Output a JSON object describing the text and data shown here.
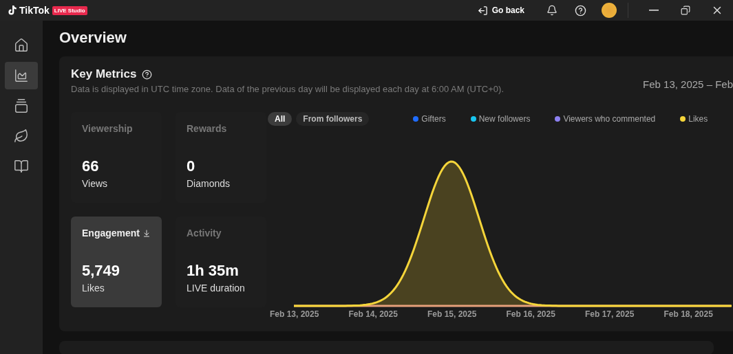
{
  "app": {
    "name": "TikTok",
    "badge": "LIVE Studio"
  },
  "titlebar": {
    "go_back": "Go back"
  },
  "sidebar": {
    "items": [
      {
        "selected": false
      },
      {
        "selected": true
      },
      {
        "selected": false
      },
      {
        "selected": false
      },
      {
        "selected": false
      }
    ]
  },
  "page_title": "Overview",
  "key_metrics": {
    "title": "Key Metrics",
    "note": "Data is displayed in UTC time zone. Data of the previous day will be displayed each day at 6:00 AM (UTC+0).",
    "date_range": "Feb 13, 2025 – Feb",
    "tiles": [
      {
        "title": "Viewership",
        "value": "66",
        "unit": "Views",
        "selected": false
      },
      {
        "title": "Rewards",
        "value": "0",
        "unit": "Diamonds",
        "selected": false
      },
      {
        "title": "Engagement",
        "value": "5,749",
        "unit": "Likes",
        "selected": true
      },
      {
        "title": "Activity",
        "value": "1h 35m",
        "unit": "LIVE duration",
        "selected": false
      }
    ]
  },
  "chart": {
    "filters": [
      {
        "label": "All",
        "selected": true
      },
      {
        "label": "From followers",
        "selected": false
      }
    ],
    "legend": [
      {
        "label": "Gifters",
        "color": "#1f6cff"
      },
      {
        "label": "New followers",
        "color": "#18c6f0"
      },
      {
        "label": "Viewers who commented",
        "color": "#8c80f0"
      },
      {
        "label": "Likes",
        "color": "#f5d53a"
      }
    ],
    "x_labels": [
      "Feb 13, 2025",
      "Feb 14, 2025",
      "Feb 15, 2025",
      "Feb 16, 2025",
      "Feb 17, 2025",
      "Feb 18, 2025"
    ]
  }
}
